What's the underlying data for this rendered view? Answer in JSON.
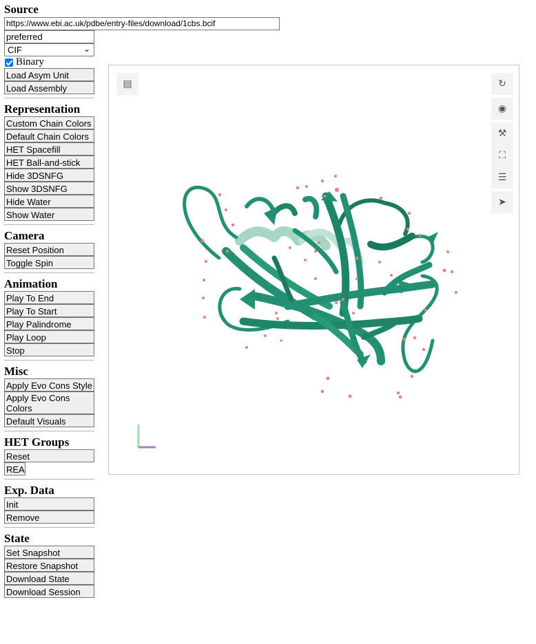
{
  "source": {
    "heading": "Source",
    "url_value": "https://www.ebi.ac.uk/pdbe/entry-files/download/1cbs.bcif",
    "preferred_value": "preferred",
    "format_selected": "CIF",
    "binary_label": "Binary",
    "load_asym_label": "Load Asym Unit",
    "load_assembly_label": "Load Assembly"
  },
  "representation": {
    "heading": "Representation",
    "buttons": [
      "Custom Chain Colors",
      "Default Chain Colors",
      "HET Spacefill",
      "HET Ball-and-stick",
      "Hide 3DSNFG",
      "Show 3DSNFG",
      "Hide Water",
      "Show Water"
    ]
  },
  "camera": {
    "heading": "Camera",
    "buttons": [
      "Reset Position",
      "Toggle Spin"
    ]
  },
  "animation": {
    "heading": "Animation",
    "buttons": [
      "Play To End",
      "Play To Start",
      "Play Palindrome",
      "Play Loop",
      "Stop"
    ]
  },
  "misc": {
    "heading": "Misc",
    "buttons": [
      "Apply Evo Cons Style",
      "Apply Evo Cons Colors",
      "Default Visuals"
    ]
  },
  "het": {
    "heading": "HET Groups",
    "buttons": [
      "Reset",
      "REA"
    ]
  },
  "exp": {
    "heading": "Exp. Data",
    "buttons": [
      "Init",
      "Remove"
    ]
  },
  "state": {
    "heading": "State",
    "buttons": [
      "Set Snapshot",
      "Restore Snapshot",
      "Download State",
      "Download Session"
    ]
  },
  "viewer": {
    "toolbar_icons": [
      "reset-camera-icon",
      "screenshot-icon",
      "settings-icon",
      "fullscreen-icon",
      "controls-icon",
      "selection-mode-icon"
    ],
    "left_icon": "animation-icon",
    "colors": {
      "ribbon": "#239073",
      "ribbon_dark": "#1b7a5e",
      "ribbon_light": "#a8d6c4",
      "water": "#e8837b",
      "axis_y": "#a6d9a6",
      "axis_x": "#a77bd6"
    }
  }
}
